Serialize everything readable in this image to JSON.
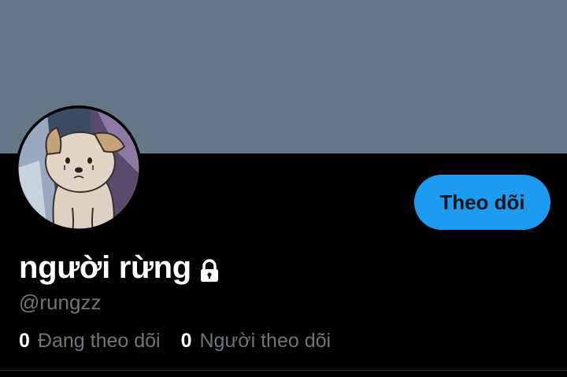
{
  "colors": {
    "banner": "#657786",
    "background": "#000000",
    "accent": "#1d9bf0",
    "primary_text": "#ffffff",
    "secondary_text": "#6e767d"
  },
  "profile": {
    "display_name": "người rừng",
    "handle": "@rungzz",
    "protected": true,
    "avatar_icon": "puppy-avatar-icon"
  },
  "actions": {
    "follow_label": "Theo dõi"
  },
  "stats": {
    "following_count": "0",
    "following_label": "Đang theo dõi",
    "followers_count": "0",
    "followers_label": "Người theo dõi"
  }
}
